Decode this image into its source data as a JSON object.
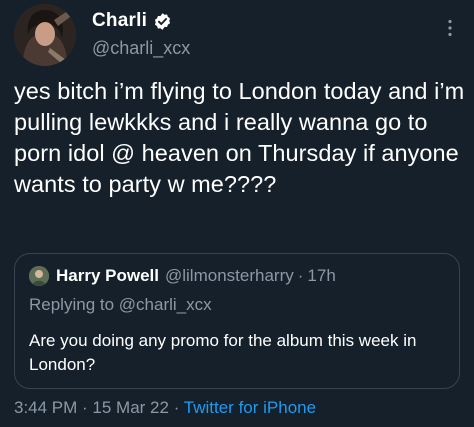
{
  "author": {
    "display_name": "Charli",
    "handle": "@charli_xcx",
    "verified_icon": "verified-badge-icon"
  },
  "tweet": {
    "text": "yes bitch i’m flying to London today and i’m pulling lewkkks and i really wanna go to porn idol @ heaven on Thursday if anyone wants to party w me????"
  },
  "quote": {
    "display_name": "Harry Powell",
    "handle": "@lilmonsterharry",
    "separator": "·",
    "time": "17h",
    "replying_to": "Replying to @charli_xcx",
    "text": "Are you doing any promo for the album this week in London?"
  },
  "meta": {
    "time": "3:44 PM",
    "separator1": " · ",
    "date": "15 Mar 22",
    "separator2": " · ",
    "source": "Twitter for iPhone"
  },
  "colors": {
    "background": "#15202b",
    "secondary_text": "#8b98a5",
    "accent": "#1d9bf0",
    "border": "#38444d"
  }
}
